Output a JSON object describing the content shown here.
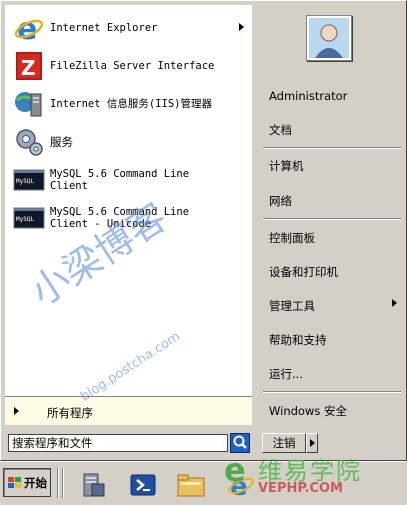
{
  "programs": [
    {
      "label": "Internet Explorer",
      "icon": "internet-explorer-icon",
      "has_submenu": true
    },
    {
      "label": "FileZilla Server Interface",
      "icon": "filezilla-icon",
      "has_submenu": false
    },
    {
      "label": "Internet 信息服务(IIS)管理器",
      "icon": "iis-manager-icon",
      "has_submenu": false
    },
    {
      "label": "服务",
      "icon": "services-gear-icon",
      "has_submenu": false
    },
    {
      "label": "MySQL 5.6 Command Line\nClient",
      "icon": "mysql-console-icon",
      "has_submenu": false
    },
    {
      "label": "MySQL 5.6 Command Line\nClient - Unicode",
      "icon": "mysql-console-icon",
      "has_submenu": false
    }
  ],
  "all_programs": {
    "label": "所有程序"
  },
  "search": {
    "placeholder": "搜索程序和文件"
  },
  "right_pane": {
    "user": "Administrator",
    "items": [
      {
        "label": "文档"
      },
      {
        "label": "计算机"
      },
      {
        "label": "网络"
      },
      {
        "label": "控制面板"
      },
      {
        "label": "设备和打印机"
      },
      {
        "label": "管理工具",
        "has_submenu": true
      },
      {
        "label": "帮助和支持"
      },
      {
        "label": "运行..."
      },
      {
        "label": "Windows 安全"
      }
    ]
  },
  "logoff": {
    "label": "注销"
  },
  "taskbar": {
    "start_label": "开始",
    "icons": [
      "server-manager-icon",
      "powershell-icon",
      "explorer-folder-icon",
      "internet-explorer-icon"
    ]
  },
  "watermarks": {
    "cn": "小梁博客",
    "url": "blog.postcha.com",
    "site_cn": "维易学院",
    "site_url": "VEPHP.COM"
  },
  "colors": {
    "menu_bg": "#d4d0c8",
    "left_pane_bg": "#ffffff",
    "all_programs_bg": "#fdfce4",
    "search_button": "#1f5fbf"
  }
}
